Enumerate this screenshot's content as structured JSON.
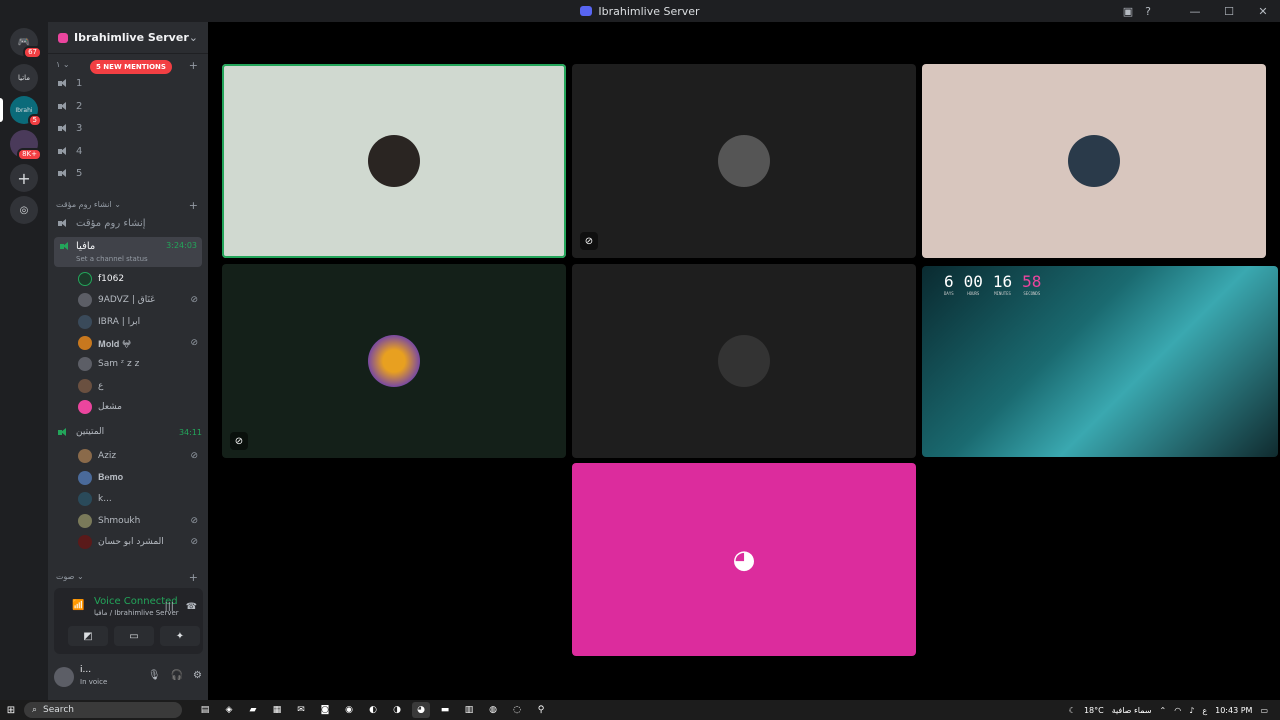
{
  "window": {
    "title": "Ibrahimlive Server"
  },
  "guilds": {
    "home_badge": "67",
    "dm_label": "ماتيا",
    "server_badge": "5",
    "folder_badge": "8K+"
  },
  "server": {
    "name": "Ibrahimlive Server",
    "mentions": "5 NEW MENTIONS"
  },
  "categories": {
    "first": "١",
    "temp": "انشاء روم مؤقت",
    "sound": "صوت"
  },
  "voice_channels": [
    "1",
    "2",
    "3",
    "4",
    "5"
  ],
  "create_channel": "إنشاء روم مؤقت",
  "active_channel": {
    "name": "مافيا",
    "timer": "3:24:03",
    "status": "Set a channel status",
    "members": [
      {
        "name": "f1062"
      },
      {
        "name": "9ADVZ | عَنَاق"
      },
      {
        "name": "IBRA | ابرا"
      },
      {
        "name": "𝐌𝐨𝐥𝐝 𖤍"
      },
      {
        "name": "Sam ᶻ z 𝗓"
      },
      {
        "name": "ع"
      },
      {
        "name": "مشعل"
      }
    ]
  },
  "second_channel": {
    "name": "المتيتين",
    "timer": "34:11",
    "members": [
      {
        "name": "Aziz"
      },
      {
        "name": "𝐁𝐞𝐦𝐨"
      },
      {
        "name": "k..."
      },
      {
        "name": "Shmoukh"
      },
      {
        "name": "المشرد ابو حسان"
      }
    ]
  },
  "voice": {
    "status": "Voice Connected",
    "location": "مافيا / Ibrahimlive Server"
  },
  "user": {
    "name": "i...",
    "status": "In voice"
  },
  "stream_clock": {
    "days": "6",
    "hours": "00",
    "minutes": "16",
    "seconds": "58",
    "u_days": "DAYS",
    "u_hours": "HOURS",
    "u_minutes": "MINUTES",
    "u_seconds": "SECONDS"
  },
  "taskbar": {
    "search": "Search",
    "weather": "18°C",
    "weather_desc": "سماء صافية",
    "lang": "ع",
    "time": "10:43 PM"
  },
  "colors": {
    "accent": "#5865f2",
    "green": "#23a55a",
    "red": "#f23f43",
    "pink_tile": "#dc2c9d"
  }
}
